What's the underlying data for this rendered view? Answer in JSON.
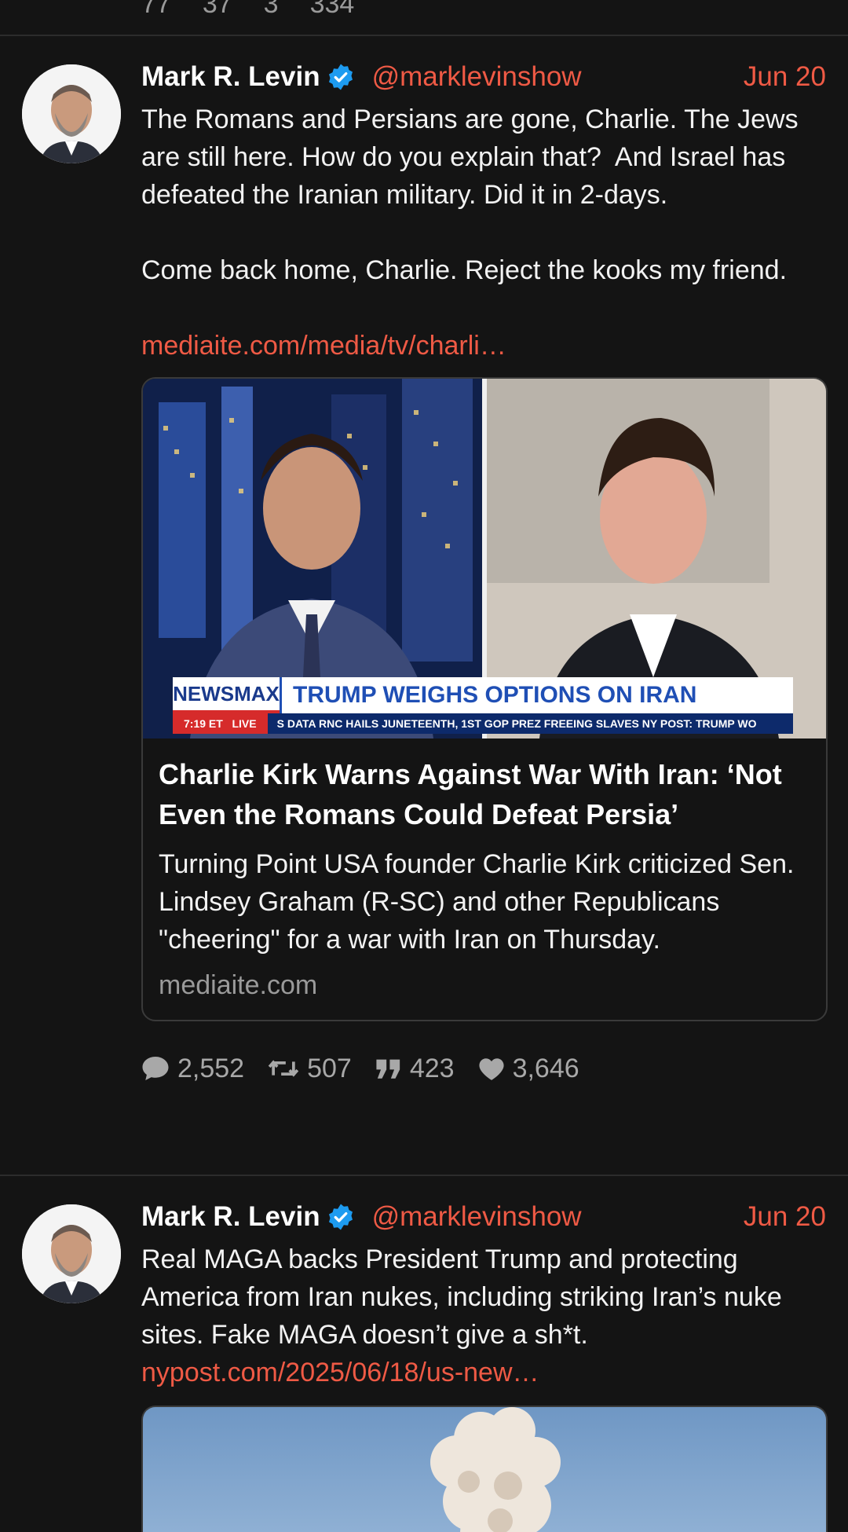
{
  "top_stats": [
    "77",
    "37",
    "3",
    "334"
  ],
  "tweets": [
    {
      "name": "Mark R. Levin",
      "handle": "@marklevinshow",
      "date": "Jun 20",
      "text": "The Romans and Persians are gone, Charlie. The Jews are still here. How do you explain that?  And Israel has defeated the Iranian military. Did it in 2-days.\n\nCome back home, Charlie. Reject the kooks my friend.",
      "link": "mediaite.com/media/tv/charli…",
      "card": {
        "title": "Charlie Kirk Warns Against War With Iran: ‘Not Even the Romans Could Defeat Persia’",
        "description": "Turning Point USA founder Charlie Kirk criticized Sen. Lindsey Graham (R-SC) and other Republicans \"cheering\" for a war with Iran on Thursday.",
        "domain": "mediaite.com",
        "chyron_brand": "NEWSMAX",
        "chyron_headline": "TRUMP WEIGHS OPTIONS ON IRAN",
        "chyron_time": "7:19 ET",
        "chyron_live": "LIVE",
        "chyron_ticker": "S DATA        RNC HAILS JUNETEENTH, 1ST GOP PREZ FREEING SLAVES        NY POST: TRUMP WO"
      },
      "stats": {
        "replies": "2,552",
        "retweets": "507",
        "quotes": "423",
        "likes": "3,646"
      }
    },
    {
      "name": "Mark R. Levin",
      "handle": "@marklevinshow",
      "date": "Jun 20",
      "text": "Real MAGA backs President Trump and protecting America from Iran nukes, including striking Iran’s nuke sites. Fake MAGA doesn’t give a sh*t.",
      "link": "nypost.com/2025/06/18/us-new…"
    }
  ],
  "colors": {
    "accent": "#ef5a45",
    "background": "#141414",
    "verified": "#1d9bf0"
  },
  "icons": [
    "reply-icon",
    "retweet-icon",
    "quote-icon",
    "heart-icon",
    "verified-icon"
  ]
}
